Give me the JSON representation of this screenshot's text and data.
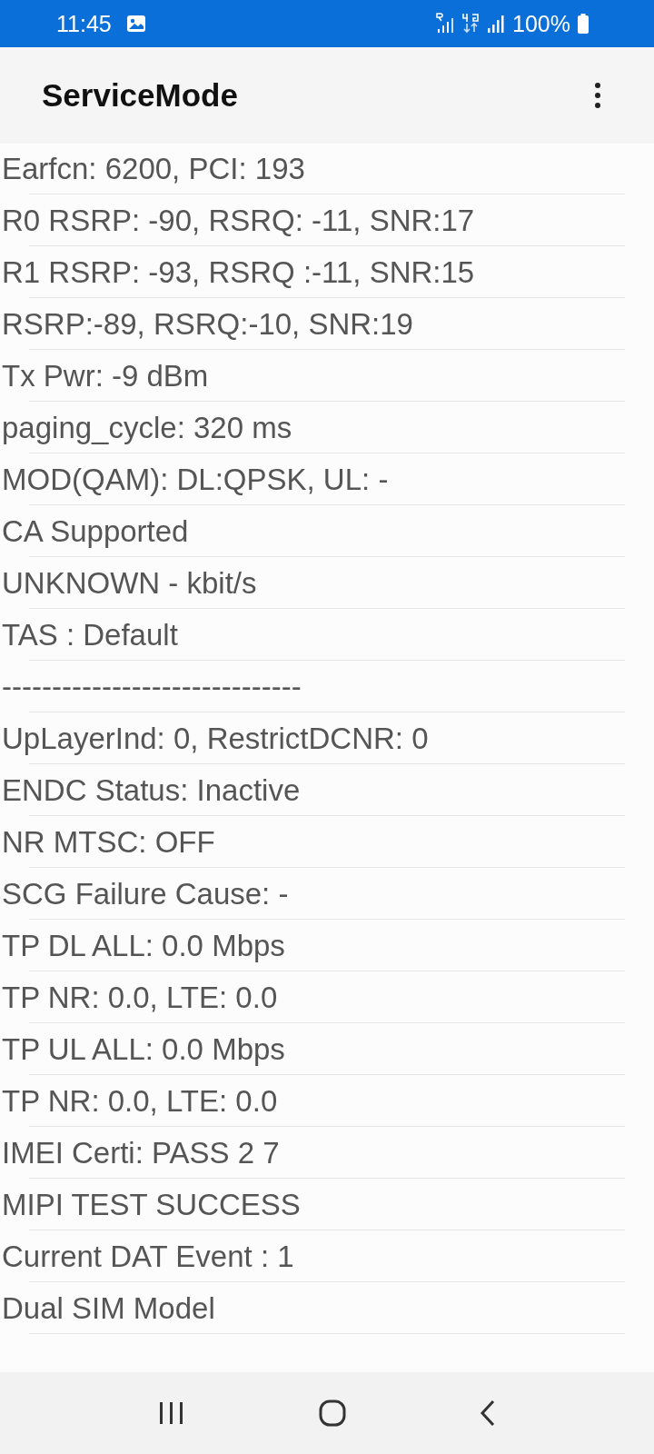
{
  "status_bar": {
    "time": "11:45",
    "battery": "100%"
  },
  "app_bar": {
    "title": "ServiceMode"
  },
  "lines": [
    "Earfcn: 6200, PCI: 193",
    "R0 RSRP: -90, RSRQ: -11, SNR:17",
    "R1 RSRP: -93, RSRQ :-11, SNR:15",
    "RSRP:-89, RSRQ:-10, SNR:19",
    "Tx Pwr: -9 dBm",
    "paging_cycle: 320 ms",
    "MOD(QAM): DL:QPSK, UL: -",
    "CA Supported",
    "UNKNOWN - kbit/s",
    "TAS : Default",
    "------------------------------",
    "UpLayerInd: 0, RestrictDCNR: 0",
    "ENDC Status: Inactive",
    "NR MTSC: OFF",
    "SCG Failure Cause: -",
    "TP DL ALL: 0.0 Mbps",
    "TP NR: 0.0, LTE: 0.0",
    "TP UL ALL: 0.0 Mbps",
    "TP NR: 0.0, LTE: 0.0",
    "IMEI Certi: PASS 2 7",
    "MIPI TEST SUCCESS",
    "Current DAT Event : 1",
    "Dual SIM Model"
  ]
}
